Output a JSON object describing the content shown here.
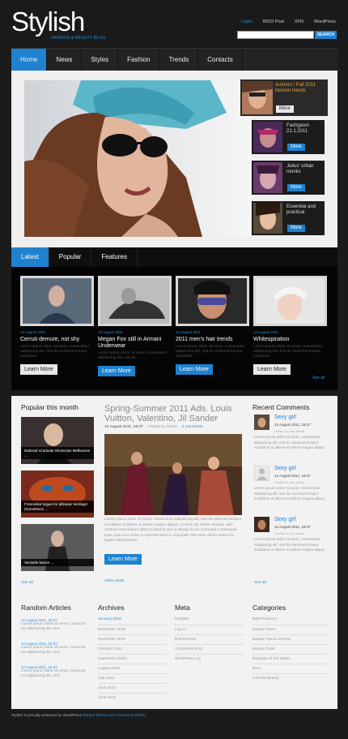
{
  "header": {
    "logo": "Stylish",
    "tagline": "FASHION & BEAUTY BLOG",
    "links": [
      "Login",
      "WOO Post",
      "XFN",
      "WordPress"
    ],
    "search_placeholder": "",
    "search_button": "SEARCH"
  },
  "nav": [
    "Home",
    "News",
    "Styles",
    "Fashion",
    "Trends",
    "Contacts"
  ],
  "hero": {
    "side": [
      {
        "title": "Autumn / Fall 2011 fashion trends",
        "button": "More"
      },
      {
        "title": "Fashgasm 21.1.2011",
        "button": "More"
      },
      {
        "title": "Julius' urban monks",
        "button": "More"
      },
      {
        "title": "Essential and practical",
        "button": "More"
      }
    ]
  },
  "tabs": [
    "Latest",
    "Popular",
    "Features"
  ],
  "latest": [
    {
      "date": "12 August 2011",
      "title": "Cerruti demure, not shy",
      "text": "Lorem ipsum dolor sit amet, consectetur adipisicing elit, sed do eiusmod tempor incididunt",
      "button": "Learn More"
    },
    {
      "date": "12 August 2011",
      "title": "Megan Fox still in Armani Underwear",
      "text": "Lorem ipsum dolor sit amet, consectetur adipisicing elit, sed do",
      "button": "Learn More"
    },
    {
      "date": "12 August 2011",
      "title": "2011 men's hair trends",
      "text": "Lorem ipsum dolor sit amet, consectetur adipisicing elit, sed do eiusmod tempor incididunt",
      "button": "Learn More"
    },
    {
      "date": "12 August 2011",
      "title": "Whitespiration",
      "text": "Lorem ipsum dolor sit amet, consectetur adipisicing elit, sed do eiusmod tempor incididunt",
      "button": "Learn More"
    }
  ],
  "see_all": "See all",
  "popular": {
    "heading": "Popular this month",
    "items": [
      "National Graduate Showcase Melbourne ...",
      "Franceska Vogue for pilliwear Verdugo! (Sometimes ...",
      "Versatile basics ..."
    ],
    "see_all": "See all"
  },
  "post": {
    "title": "Spring-Summer 2011 Ads. Louis Vuitton, Valentino, Jil Sander",
    "date": "12 August 2011, 18:37",
    "posted_by": "Posted by Admin",
    "comments": "4 comments",
    "text": "Lorem ipsum dolor sit amet, consectetur adipisicing elit, sed do eiusmod tempor incididunt ut labore et dolore magna aliqua. Ut enim ad minim veniam, quis nostrud exercitation ullamco laboris nisi ut aliquip ex ea commodo consequat. Duis aute irure dolor in reprehenderit in voluptate velit esse cillum dolore eu fugiat nulla pariatur.",
    "button": "Learn More",
    "older": "Older posts"
  },
  "comments": {
    "heading": "Recent Comments",
    "items": [
      {
        "name": "Sexy girl",
        "date": "12 August 2011, 18:37",
        "small": "Posted in your article",
        "text": "Lorem ipsum dolor sit amet, consectetur adipisicing elit, sed do eiusmod tempor incididunt ut labore et dolore magna aliqua."
      },
      {
        "name": "Sexy girl",
        "date": "12 August 2011, 18:37",
        "small": "Posted in your article",
        "text": "Lorem ipsum dolor sit amet, consectetur adipisicing elit, sed do eiusmod tempor incididunt ut labore et dolore magna aliqua."
      },
      {
        "name": "Sexy girl",
        "date": "12 August 2011, 18:37",
        "small": "Posted in your article",
        "text": "Lorem ipsum dolor sit amet, consectetur adipisicing elit, sed do eiusmod tempor incididunt ut labore et dolore magna aliqua."
      }
    ],
    "see_all": "See all"
  },
  "random": {
    "heading": "Random Articles",
    "items": [
      {
        "date": "12 August 2011, 18:37",
        "text": "Lorem ipsum dolor sit amet, consecte tur adipisicing elit, sed"
      },
      {
        "date": "12 August 2011, 18:37",
        "text": "Lorem ipsum dolor sit amet, consecte tur adipisicing elit, sed"
      },
      {
        "date": "12 August 2011, 18:37",
        "text": "Lorem ipsum dolor sit amet, consecte tur adipisicing elit, sed"
      }
    ]
  },
  "archives": {
    "heading": "Archives",
    "items": [
      "January 2011",
      "December 2010",
      "November 2010",
      "October 2010",
      "September 2010",
      "August 2010",
      "July 2010",
      "June 2010",
      "June 2010"
    ]
  },
  "meta": {
    "heading": "Meta",
    "items": [
      "Register",
      "Log in",
      "Entries RSS",
      "Comments RSS",
      "WordPress.org"
    ]
  },
  "categories": {
    "heading": "Categories",
    "items": [
      "Bath Products",
      "Beauty News",
      "Beauty Tips & Secrets",
      "Beauty Tools",
      "Boutique of the Week",
      "Bras",
      "Colorful Beauty"
    ]
  },
  "footer": {
    "text": "Stylish is proudly powered by WordPress",
    "links": "Entries (RSS) and Comments (RSS)"
  }
}
